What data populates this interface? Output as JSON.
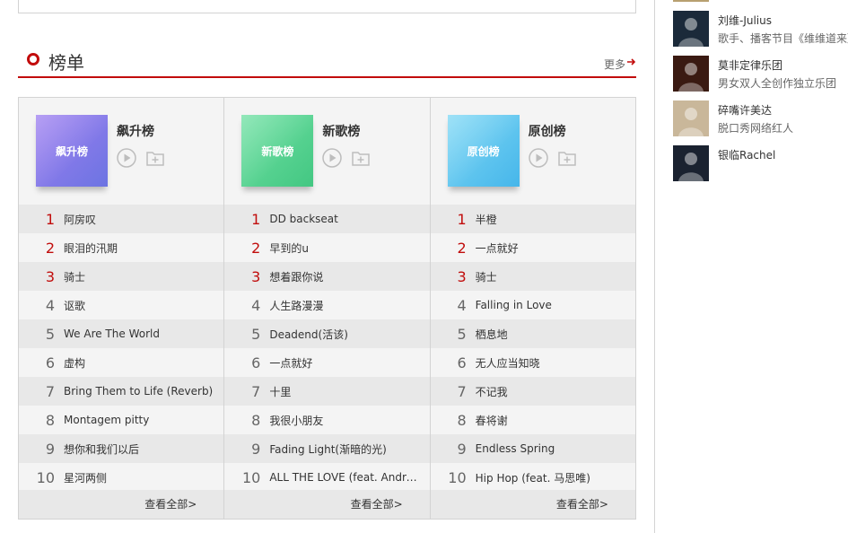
{
  "section": {
    "title": "榜单",
    "more_label": "更多"
  },
  "boards": [
    {
      "title": "飙升榜",
      "cover_label": "飙升榜",
      "cover_color_a": "#9e7ff0",
      "cover_color_b": "#6c74e2",
      "view_all": "查看全部>",
      "songs": [
        {
          "rank": "1",
          "name": "阿房叹"
        },
        {
          "rank": "2",
          "name": "眼泪的汛期"
        },
        {
          "rank": "3",
          "name": "骑士"
        },
        {
          "rank": "4",
          "name": "讴歌"
        },
        {
          "rank": "5",
          "name": "We Are The World"
        },
        {
          "rank": "6",
          "name": "虚构"
        },
        {
          "rank": "7",
          "name": "Bring Them to Life (Reverb)"
        },
        {
          "rank": "8",
          "name": "Montagem pitty"
        },
        {
          "rank": "9",
          "name": "想你和我们以后"
        },
        {
          "rank": "10",
          "name": "星河两侧"
        }
      ]
    },
    {
      "title": "新歌榜",
      "cover_label": "新歌榜",
      "cover_color_a": "#6fe0a3",
      "cover_color_b": "#43c782",
      "view_all": "查看全部>",
      "songs": [
        {
          "rank": "1",
          "name": "DD backseat"
        },
        {
          "rank": "2",
          "name": "早到的u"
        },
        {
          "rank": "3",
          "name": "想着跟你说"
        },
        {
          "rank": "4",
          "name": "人生路漫漫"
        },
        {
          "rank": "5",
          "name": "Deadend(活该)"
        },
        {
          "rank": "6",
          "name": "一点就好"
        },
        {
          "rank": "7",
          "name": "十里"
        },
        {
          "rank": "8",
          "name": "我很小朋友"
        },
        {
          "rank": "9",
          "name": "Fading Light(渐暗的光)"
        },
        {
          "rank": "10",
          "name": "ALL THE LOVE (feat. Andre Power)"
        }
      ]
    },
    {
      "title": "原创榜",
      "cover_label": "原创榜",
      "cover_color_a": "#7fd8f5",
      "cover_color_b": "#46b6ea",
      "view_all": "查看全部>",
      "songs": [
        {
          "rank": "1",
          "name": "半橙"
        },
        {
          "rank": "2",
          "name": "一点就好"
        },
        {
          "rank": "3",
          "name": "骑士"
        },
        {
          "rank": "4",
          "name": "Falling in Love"
        },
        {
          "rank": "5",
          "name": "栖息地"
        },
        {
          "rank": "6",
          "name": "无人应当知晓"
        },
        {
          "rank": "7",
          "name": "不记我"
        },
        {
          "rank": "8",
          "name": "春将谢"
        },
        {
          "rank": "9",
          "name": "Endless Spring"
        },
        {
          "rank": "10",
          "name": "Hip Hop (feat. 马思唯)"
        }
      ]
    }
  ],
  "artists": [
    {
      "name": "刘维-Julius",
      "desc": "歌手、播客节目《维维道来》主播",
      "avatar_color": "#1b2a3a"
    },
    {
      "name": "莫非定律乐团",
      "desc": "男女双人全创作独立乐团",
      "avatar_color": "#3a1a12"
    },
    {
      "name": "碎嘴许美达",
      "desc": "脱口秀网络红人",
      "avatar_color": "#c9b79a"
    },
    {
      "name": "银临Rachel",
      "desc": "",
      "avatar_color": "#1a2230"
    }
  ],
  "colors": {
    "accent": "#c20c0c",
    "rank_top": "#c10d0c"
  }
}
